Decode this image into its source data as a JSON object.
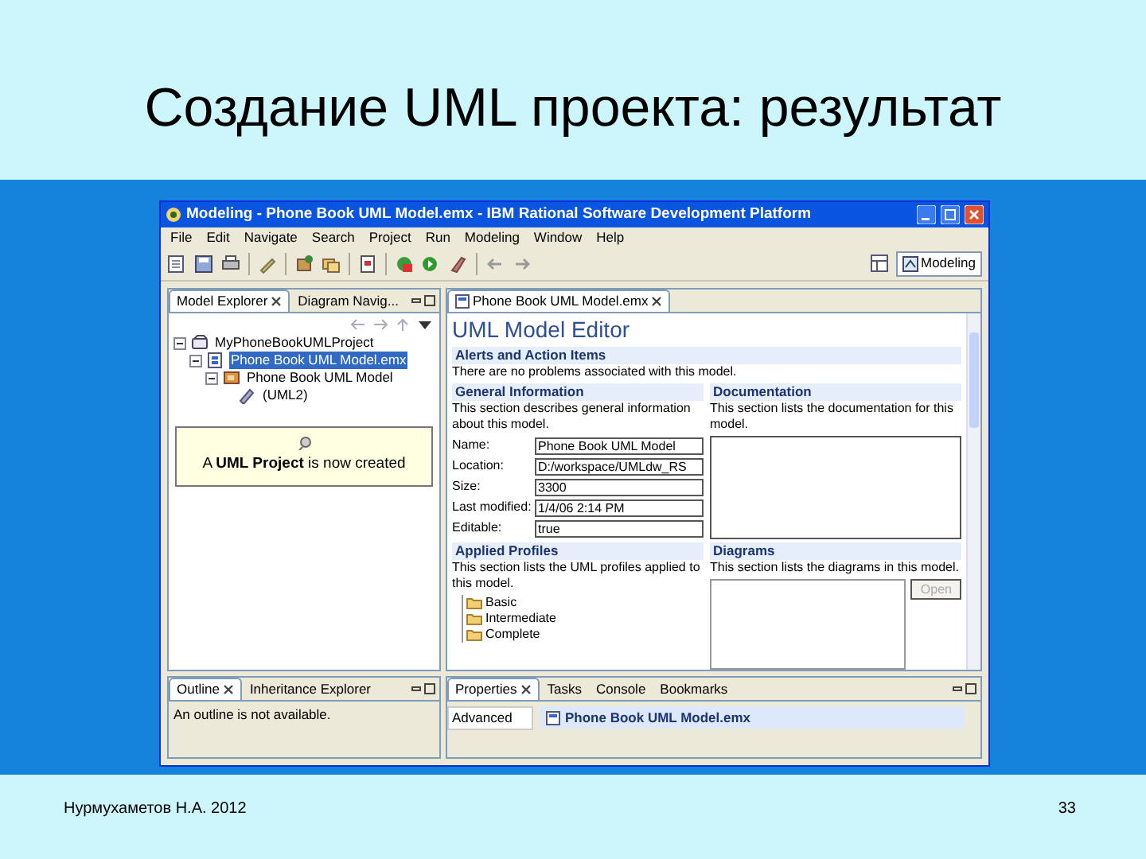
{
  "slide": {
    "title": "Создание UML проекта: результат",
    "footer_left": "Нурмухаметов Н.А. 2012",
    "page_number": "33"
  },
  "window": {
    "title": "Modeling - Phone Book UML Model.emx - IBM Rational Software Development Platform"
  },
  "menu": [
    "File",
    "Edit",
    "Navigate",
    "Search",
    "Project",
    "Run",
    "Modeling",
    "Window",
    "Help"
  ],
  "perspective": {
    "label": "Modeling",
    "selected": true
  },
  "explorer": {
    "tabs": [
      {
        "label": "Model Explorer",
        "selected": true
      },
      {
        "label": "Diagram Navig...",
        "selected": false
      }
    ],
    "tree": [
      {
        "label": "MyPhoneBookUMLProject",
        "kind": "project",
        "expanded": true,
        "selected": false,
        "children": [
          {
            "label": "Phone Book UML Model.emx",
            "kind": "file",
            "expanded": true,
            "selected": true,
            "children": [
              {
                "label": "Phone Book UML Model",
                "kind": "model",
                "expanded": true,
                "selected": false,
                "children": [
                  {
                    "label": "(UML2)",
                    "kind": "library",
                    "selected": false
                  }
                ]
              }
            ]
          }
        ]
      }
    ]
  },
  "tooltip": {
    "text": "A **UML Project** is now created"
  },
  "editor": {
    "tab": "Phone Book UML Model.emx",
    "heading": "UML Model Editor",
    "alerts": {
      "title": "Alerts and Action Items",
      "text": "There are no problems associated with this model."
    },
    "general": {
      "title": "General Information",
      "text": "This section describes general information about this model.",
      "fields": [
        {
          "label": "Name:",
          "value": "Phone Book UML Model"
        },
        {
          "label": "Location:",
          "value": "D:/workspace/UMLdw_RS"
        },
        {
          "label": "Size:",
          "value": "3300"
        },
        {
          "label": "Last modified:",
          "value": "1/4/06 2:14 PM"
        },
        {
          "label": "Editable:",
          "value": "true"
        }
      ]
    },
    "documentation": {
      "title": "Documentation",
      "text": "This section lists the documentation for this model."
    },
    "profiles": {
      "title": "Applied Profiles",
      "text": "This section lists the UML profiles applied to this model.",
      "items": [
        "Basic",
        "Intermediate",
        "Complete"
      ]
    },
    "diagrams": {
      "title": "Diagrams",
      "text": "This section lists the diagrams in this model.",
      "button": {
        "label": "Open",
        "disabled": true
      }
    }
  },
  "outline": {
    "tabs": [
      {
        "label": "Outline",
        "selected": true
      },
      {
        "label": "Inheritance Explorer",
        "selected": false
      }
    ],
    "message": "An outline is not available."
  },
  "properties": {
    "tabs": [
      {
        "label": "Properties",
        "selected": true
      },
      {
        "label": "Tasks",
        "selected": false
      },
      {
        "label": "Console",
        "selected": false
      },
      {
        "label": "Bookmarks",
        "selected": false
      }
    ],
    "category": "Advanced",
    "selection": "Phone Book UML Model.emx"
  }
}
